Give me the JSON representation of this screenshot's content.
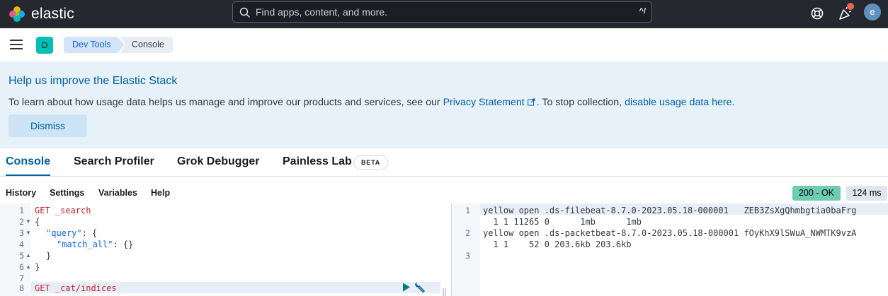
{
  "header": {
    "brand": "elastic",
    "search_placeholder": "Find apps, content, and more.",
    "search_shortcut": "^/",
    "avatar_initial": "e"
  },
  "breadcrumbs": {
    "space_initial": "D",
    "items": [
      "Dev Tools",
      "Console"
    ]
  },
  "banner": {
    "title": "Help us improve the Elastic Stack",
    "text_before": "To learn about how usage data helps us manage and improve our products and services, see our ",
    "privacy_link": "Privacy Statement",
    "text_middle": ". To stop collection, ",
    "disable_link": "disable usage data here.",
    "dismiss_label": "Dismiss"
  },
  "tabs": [
    {
      "label": "Console",
      "active": true
    },
    {
      "label": "Search Profiler",
      "active": false
    },
    {
      "label": "Grok Debugger",
      "active": false
    },
    {
      "label": "Painless Lab",
      "active": false
    }
  ],
  "beta_label": "BETA",
  "console_menu": [
    "History",
    "Settings",
    "Variables",
    "Help"
  ],
  "status": {
    "code": "200 - OK",
    "time": "124 ms"
  },
  "editor": {
    "line_numbers": [
      "1",
      "2",
      "3",
      "4",
      "5",
      "6",
      "7",
      "8"
    ],
    "line1_method": "GET",
    "line1_path": "_search",
    "line2": "{",
    "line3_key": "\"query\"",
    "line3_rest": ": {",
    "line4_key": "\"match_all\"",
    "line4_rest": ": {}",
    "line5": "}",
    "line6": "}",
    "line8_method": "GET",
    "line8_path": "_cat/indices"
  },
  "output": {
    "line_numbers": [
      "1",
      "2",
      "3"
    ],
    "row1a": "yellow open .ds-filebeat-8.7.0-2023.05.18-000001   ZEB3ZsXgQhmbgtia0baFrg",
    "row1b": "  1 1 11265 0      1mb      1mb",
    "row2a": "yellow open .ds-packetbeat-8.7.0-2023.05.18-000001 fOyKhX9lSWuA_NWMTK9vzA",
    "row2b": "  1 1    52 0 203.6kb 203.6kb"
  },
  "colors": {
    "topbar": "#25282f",
    "accent": "#0061a6",
    "status_ok": "#6dccb1",
    "space_badge": "#00bfb3"
  }
}
